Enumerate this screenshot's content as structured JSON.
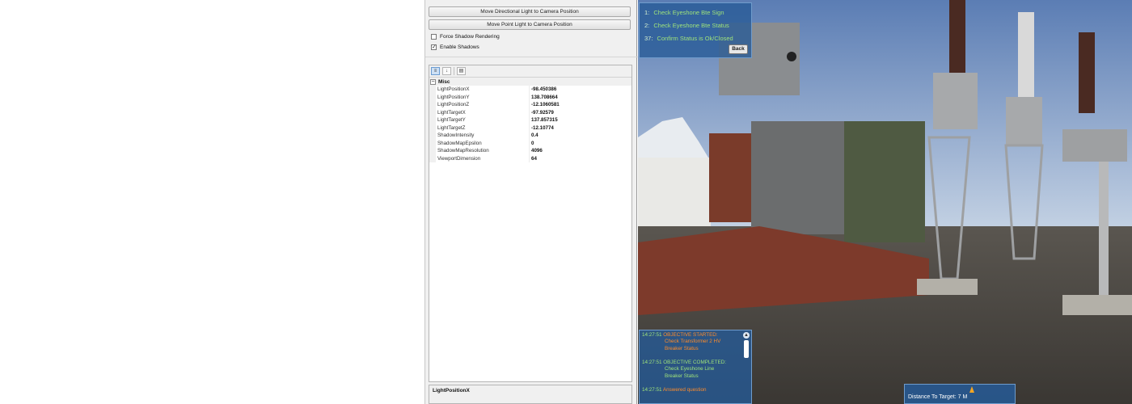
{
  "panel": {
    "buttons": {
      "directional_light": "Move Directional Light to Camera Position",
      "point_light": "Move Point Light to Camera Position"
    },
    "checkboxes": {
      "force_shadow": {
        "label": "Force Shadow Rendering",
        "checked": false
      },
      "enable_shadows": {
        "label": "Enable Shadows",
        "checked": true
      }
    },
    "grid": {
      "category": "Misc",
      "properties": [
        {
          "name": "LightPositionX",
          "value": "-98.450386"
        },
        {
          "name": "LightPositionY",
          "value": "138.708664"
        },
        {
          "name": "LightPositionZ",
          "value": "-12.1060581"
        },
        {
          "name": "LightTargetX",
          "value": "-97.92579"
        },
        {
          "name": "LightTargetY",
          "value": "137.857315"
        },
        {
          "name": "LightTargetZ",
          "value": "-12.10774"
        },
        {
          "name": "ShadowIntensity",
          "value": "0.4"
        },
        {
          "name": "ShadowMapEpsilon",
          "value": "0"
        },
        {
          "name": "ShadowMapResolution",
          "value": "4096"
        },
        {
          "name": "ViewportDimension",
          "value": "64"
        }
      ]
    },
    "description_title": "LightPositionX"
  },
  "objectives": {
    "items": [
      {
        "num": "1:",
        "text": "Check Eyeshone Bte Sign"
      },
      {
        "num": "2:",
        "text": "Check Eyeshone Bte Status"
      },
      {
        "num": "37:",
        "text": "Confirm Status is Ok/Closed"
      }
    ],
    "back_label": "Back"
  },
  "log": {
    "entries": [
      {
        "time": "14:27:51",
        "head": "OBJECTIVE STARTED:",
        "body1": "Check Transformer 2 HV",
        "body2": "Breaker Status",
        "done": false
      },
      {
        "time": "14:27:51",
        "head": "OBJECTIVE COMPLETED:",
        "body1": "Check Eyeshone Line",
        "body2": "Breaker Status",
        "done": true
      },
      {
        "time": "14:27:51",
        "head": "Answered question",
        "body1": "",
        "body2": "",
        "done": false
      }
    ]
  },
  "distance": {
    "label": "Distance To Target:",
    "value": "7 M"
  },
  "colors": {
    "hud_bg": "#265a96",
    "hud_green": "#9fe37a",
    "hud_orange": "#ff8c2a"
  }
}
